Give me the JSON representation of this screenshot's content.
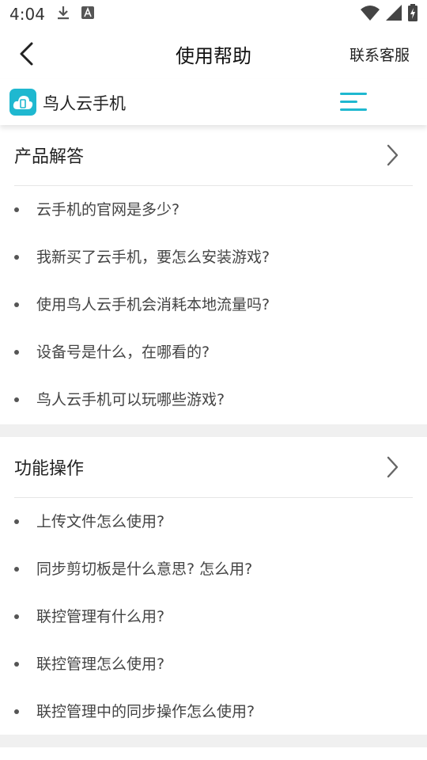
{
  "status": {
    "time": "4:04",
    "icons": [
      "download-icon",
      "notification-a-icon",
      "wifi-icon",
      "signal-icon",
      "battery-icon"
    ]
  },
  "appbar": {
    "title": "使用帮助",
    "contact": "联系客服",
    "back_icon": "chevron-left-icon"
  },
  "brand": {
    "name": "鸟人云手机",
    "logo_icon": "cloud-phone-icon",
    "menu_icon": "menu-icon",
    "accent": "#1fb8d0"
  },
  "sections": [
    {
      "title": "产品解答",
      "questions": [
        "云手机的官网是多少?",
        "我新买了云手机，要怎么安装游戏?",
        "使用鸟人云手机会消耗本地流量吗?",
        "设备号是什么，在哪看的?",
        "鸟人云手机可以玩哪些游戏?"
      ]
    },
    {
      "title": "功能操作",
      "questions": [
        "上传文件怎么使用?",
        "同步剪切板是什么意思? 怎么用?",
        "联控管理有什么用?",
        "联控管理怎么使用?",
        "联控管理中的同步操作怎么使用?"
      ]
    }
  ]
}
